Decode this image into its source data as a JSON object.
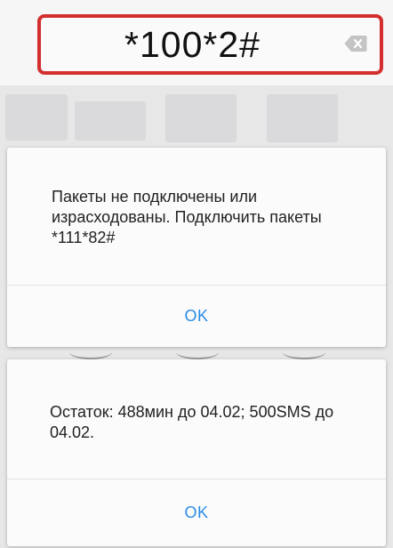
{
  "dialer": {
    "entered_code": "*100*2#",
    "backspace_icon": "backspace-icon"
  },
  "dialogs": [
    {
      "message": "Пакеты не подключены или израсходованы. Подключить пакеты *111*82#",
      "button_label": "OK"
    },
    {
      "message": "Остаток: 488мин до 04.02; 500SMS до 04.02.",
      "button_label": "OK"
    }
  ],
  "colors": {
    "highlight_border": "#d32f2f",
    "button_text": "#2a8ce6"
  }
}
